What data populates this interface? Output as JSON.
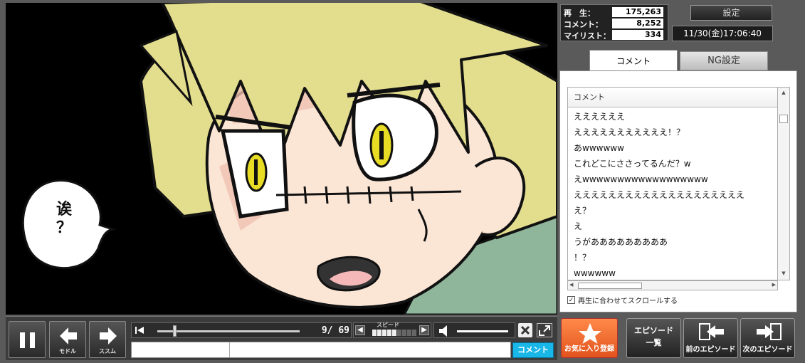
{
  "video": {
    "speech_bubble": "诶\n？"
  },
  "controls": {
    "back_label": "モドル",
    "forward_label": "ススム",
    "time": "9/ 69",
    "speed_label": "スピード",
    "speed_level": 0.55,
    "comment_placeholder": "",
    "comment_submit": "コメント"
  },
  "stats": {
    "play_label": "再　生：",
    "play_count": "175,263",
    "comment_label": "コメント：",
    "comment_count": "8,252",
    "mylist_label": "マイリスト：",
    "mylist_count": "334"
  },
  "settings_label": "設定",
  "datetime": "11/30(金)17:06:40",
  "tabs": {
    "comment": "コメント",
    "ng": "NG設定"
  },
  "comment_panel": {
    "header": "コメント",
    "comments": [
      "ええええええ",
      "えええええええええええ！？",
      "あwwwwww",
      "これどこにささってるんだ？w",
      "えwwwwwwwwwwwwwwwwww",
      "ええええええええええええええええええええ",
      "え？",
      "え",
      "うがあああああああああ",
      "！？",
      "wwwwww"
    ],
    "autoscroll_label": "再生に合わせてスクロールする",
    "autoscroll_checked": "✓"
  },
  "buttons": {
    "mylist": "お気に入り登録",
    "episode_list": "エピソード\n一覧",
    "prev_episode": "前のエピソード",
    "next_episode": "次のエピソード"
  },
  "colors": {
    "comment_submit_bg": "#19b6e8",
    "mylist_bg": "#e2531d",
    "hair": "#e3dd8e",
    "eye": "#e8dc24"
  }
}
